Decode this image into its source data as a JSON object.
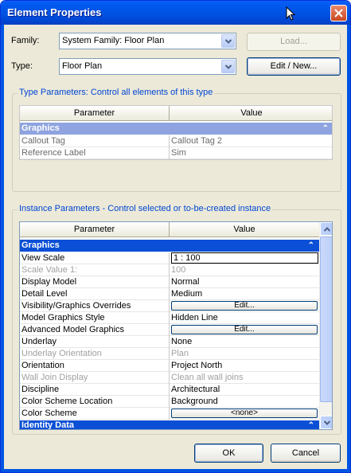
{
  "window": {
    "title": "Element Properties",
    "close_label": "close"
  },
  "family": {
    "label": "Family:",
    "value": "System Family: Floor Plan"
  },
  "type": {
    "label": "Type:",
    "value": "Floor Plan"
  },
  "buttons": {
    "load": "Load...",
    "edit_new": "Edit / New...",
    "ok": "OK",
    "cancel": "Cancel"
  },
  "type_parameters": {
    "group_title": "Type Parameters: Control all elements of this type",
    "columns": [
      "Parameter",
      "Value"
    ],
    "section": "Graphics",
    "rows": [
      {
        "param": "Callout Tag",
        "value": "Callout Tag 2"
      },
      {
        "param": "Reference Label",
        "value": "Sim"
      }
    ]
  },
  "instance_parameters": {
    "group_title": "Instance Parameters - Control selected or to-be-created instance",
    "columns": [
      "Parameter",
      "Value"
    ],
    "section": "Graphics",
    "next_section": "Identity Data",
    "rows": [
      {
        "param": "View Scale",
        "value": "1 : 100"
      },
      {
        "param": "Scale Value    1:",
        "value": "100"
      },
      {
        "param": "Display Model",
        "value": "Normal"
      },
      {
        "param": "Detail Level",
        "value": "Medium"
      },
      {
        "param": "Visibility/Graphics Overrides",
        "value": "Edit..."
      },
      {
        "param": "Model Graphics Style",
        "value": "Hidden Line"
      },
      {
        "param": "Advanced Model Graphics",
        "value": "Edit..."
      },
      {
        "param": "Underlay",
        "value": "None"
      },
      {
        "param": "Underlay Orientation",
        "value": "Plan"
      },
      {
        "param": "Orientation",
        "value": "Project North"
      },
      {
        "param": "Wall Join Display",
        "value": "Clean all wall joins"
      },
      {
        "param": "Discipline",
        "value": "Architectural"
      },
      {
        "param": "Color Scheme Location",
        "value": "Background"
      },
      {
        "param": "Color Scheme",
        "value": "<none>"
      }
    ]
  }
}
